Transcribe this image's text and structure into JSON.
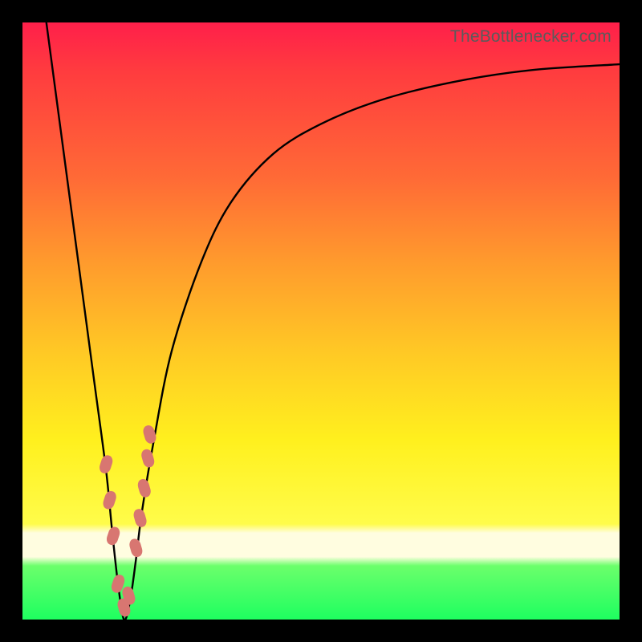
{
  "attribution": "TheBottlenecker.com",
  "colors": {
    "marker": "#d87671",
    "curve": "#000000",
    "frame": "#000000"
  },
  "chart_data": {
    "type": "line",
    "title": "",
    "xlabel": "",
    "ylabel": "",
    "xlim": [
      0,
      100
    ],
    "ylim": [
      0,
      100
    ],
    "note": "Bottleneck-style V curve. x = relative hardware index (arbitrary %), y = bottleneck %. Axes unlabeled in source image; values estimated from pixel positions.",
    "series": [
      {
        "name": "bottleneck-curve",
        "x": [
          4,
          6,
          8,
          10,
          12,
          14,
          15,
          16,
          17,
          18,
          19,
          20,
          22,
          25,
          30,
          35,
          42,
          50,
          60,
          72,
          85,
          100
        ],
        "y": [
          100,
          85,
          70,
          55,
          40,
          25,
          15,
          6,
          0,
          3,
          10,
          18,
          30,
          45,
          60,
          70,
          78,
          83,
          87,
          90,
          92,
          93
        ]
      }
    ],
    "markers": {
      "name": "highlight-dots",
      "shape": "rounded-rect",
      "x": [
        14.0,
        14.6,
        15.2,
        16.0,
        17.0,
        17.8,
        19.0,
        19.7,
        20.4,
        21.0,
        21.3
      ],
      "y": [
        26,
        20,
        14,
        6,
        2,
        4,
        12,
        17,
        22,
        27,
        31
      ]
    }
  }
}
